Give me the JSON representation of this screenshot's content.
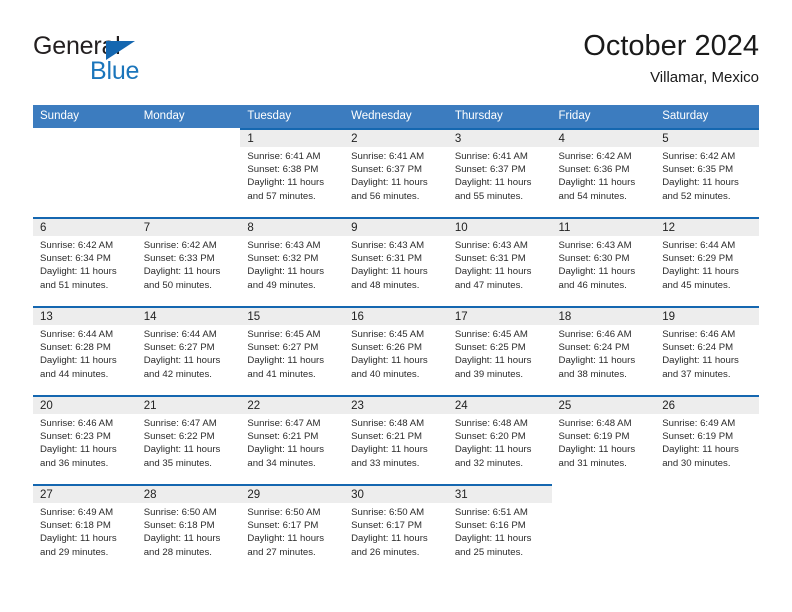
{
  "brand": {
    "line1": "General",
    "line2": "Blue",
    "triangle_color": "#1567b0",
    "blue_color": "#1a75bb"
  },
  "header": {
    "title": "October 2024",
    "subtitle": "Villamar, Mexico"
  },
  "colors": {
    "header_blue": "#3c7cbf",
    "row_rule_blue": "#1567b0",
    "daynum_band": "#ededed"
  },
  "weekdays": [
    "Sunday",
    "Monday",
    "Tuesday",
    "Wednesday",
    "Thursday",
    "Friday",
    "Saturday"
  ],
  "weeks": [
    [
      {
        "day": ""
      },
      {
        "day": ""
      },
      {
        "day": "1",
        "sunrise": "Sunrise: 6:41 AM",
        "sunset": "Sunset: 6:38 PM",
        "daylight": "Daylight: 11 hours and 57 minutes."
      },
      {
        "day": "2",
        "sunrise": "Sunrise: 6:41 AM",
        "sunset": "Sunset: 6:37 PM",
        "daylight": "Daylight: 11 hours and 56 minutes."
      },
      {
        "day": "3",
        "sunrise": "Sunrise: 6:41 AM",
        "sunset": "Sunset: 6:37 PM",
        "daylight": "Daylight: 11 hours and 55 minutes."
      },
      {
        "day": "4",
        "sunrise": "Sunrise: 6:42 AM",
        "sunset": "Sunset: 6:36 PM",
        "daylight": "Daylight: 11 hours and 54 minutes."
      },
      {
        "day": "5",
        "sunrise": "Sunrise: 6:42 AM",
        "sunset": "Sunset: 6:35 PM",
        "daylight": "Daylight: 11 hours and 52 minutes."
      }
    ],
    [
      {
        "day": "6",
        "sunrise": "Sunrise: 6:42 AM",
        "sunset": "Sunset: 6:34 PM",
        "daylight": "Daylight: 11 hours and 51 minutes."
      },
      {
        "day": "7",
        "sunrise": "Sunrise: 6:42 AM",
        "sunset": "Sunset: 6:33 PM",
        "daylight": "Daylight: 11 hours and 50 minutes."
      },
      {
        "day": "8",
        "sunrise": "Sunrise: 6:43 AM",
        "sunset": "Sunset: 6:32 PM",
        "daylight": "Daylight: 11 hours and 49 minutes."
      },
      {
        "day": "9",
        "sunrise": "Sunrise: 6:43 AM",
        "sunset": "Sunset: 6:31 PM",
        "daylight": "Daylight: 11 hours and 48 minutes."
      },
      {
        "day": "10",
        "sunrise": "Sunrise: 6:43 AM",
        "sunset": "Sunset: 6:31 PM",
        "daylight": "Daylight: 11 hours and 47 minutes."
      },
      {
        "day": "11",
        "sunrise": "Sunrise: 6:43 AM",
        "sunset": "Sunset: 6:30 PM",
        "daylight": "Daylight: 11 hours and 46 minutes."
      },
      {
        "day": "12",
        "sunrise": "Sunrise: 6:44 AM",
        "sunset": "Sunset: 6:29 PM",
        "daylight": "Daylight: 11 hours and 45 minutes."
      }
    ],
    [
      {
        "day": "13",
        "sunrise": "Sunrise: 6:44 AM",
        "sunset": "Sunset: 6:28 PM",
        "daylight": "Daylight: 11 hours and 44 minutes."
      },
      {
        "day": "14",
        "sunrise": "Sunrise: 6:44 AM",
        "sunset": "Sunset: 6:27 PM",
        "daylight": "Daylight: 11 hours and 42 minutes."
      },
      {
        "day": "15",
        "sunrise": "Sunrise: 6:45 AM",
        "sunset": "Sunset: 6:27 PM",
        "daylight": "Daylight: 11 hours and 41 minutes."
      },
      {
        "day": "16",
        "sunrise": "Sunrise: 6:45 AM",
        "sunset": "Sunset: 6:26 PM",
        "daylight": "Daylight: 11 hours and 40 minutes."
      },
      {
        "day": "17",
        "sunrise": "Sunrise: 6:45 AM",
        "sunset": "Sunset: 6:25 PM",
        "daylight": "Daylight: 11 hours and 39 minutes."
      },
      {
        "day": "18",
        "sunrise": "Sunrise: 6:46 AM",
        "sunset": "Sunset: 6:24 PM",
        "daylight": "Daylight: 11 hours and 38 minutes."
      },
      {
        "day": "19",
        "sunrise": "Sunrise: 6:46 AM",
        "sunset": "Sunset: 6:24 PM",
        "daylight": "Daylight: 11 hours and 37 minutes."
      }
    ],
    [
      {
        "day": "20",
        "sunrise": "Sunrise: 6:46 AM",
        "sunset": "Sunset: 6:23 PM",
        "daylight": "Daylight: 11 hours and 36 minutes."
      },
      {
        "day": "21",
        "sunrise": "Sunrise: 6:47 AM",
        "sunset": "Sunset: 6:22 PM",
        "daylight": "Daylight: 11 hours and 35 minutes."
      },
      {
        "day": "22",
        "sunrise": "Sunrise: 6:47 AM",
        "sunset": "Sunset: 6:21 PM",
        "daylight": "Daylight: 11 hours and 34 minutes."
      },
      {
        "day": "23",
        "sunrise": "Sunrise: 6:48 AM",
        "sunset": "Sunset: 6:21 PM",
        "daylight": "Daylight: 11 hours and 33 minutes."
      },
      {
        "day": "24",
        "sunrise": "Sunrise: 6:48 AM",
        "sunset": "Sunset: 6:20 PM",
        "daylight": "Daylight: 11 hours and 32 minutes."
      },
      {
        "day": "25",
        "sunrise": "Sunrise: 6:48 AM",
        "sunset": "Sunset: 6:19 PM",
        "daylight": "Daylight: 11 hours and 31 minutes."
      },
      {
        "day": "26",
        "sunrise": "Sunrise: 6:49 AM",
        "sunset": "Sunset: 6:19 PM",
        "daylight": "Daylight: 11 hours and 30 minutes."
      }
    ],
    [
      {
        "day": "27",
        "sunrise": "Sunrise: 6:49 AM",
        "sunset": "Sunset: 6:18 PM",
        "daylight": "Daylight: 11 hours and 29 minutes."
      },
      {
        "day": "28",
        "sunrise": "Sunrise: 6:50 AM",
        "sunset": "Sunset: 6:18 PM",
        "daylight": "Daylight: 11 hours and 28 minutes."
      },
      {
        "day": "29",
        "sunrise": "Sunrise: 6:50 AM",
        "sunset": "Sunset: 6:17 PM",
        "daylight": "Daylight: 11 hours and 27 minutes."
      },
      {
        "day": "30",
        "sunrise": "Sunrise: 6:50 AM",
        "sunset": "Sunset: 6:17 PM",
        "daylight": "Daylight: 11 hours and 26 minutes."
      },
      {
        "day": "31",
        "sunrise": "Sunrise: 6:51 AM",
        "sunset": "Sunset: 6:16 PM",
        "daylight": "Daylight: 11 hours and 25 minutes."
      },
      {
        "day": ""
      },
      {
        "day": ""
      }
    ]
  ]
}
